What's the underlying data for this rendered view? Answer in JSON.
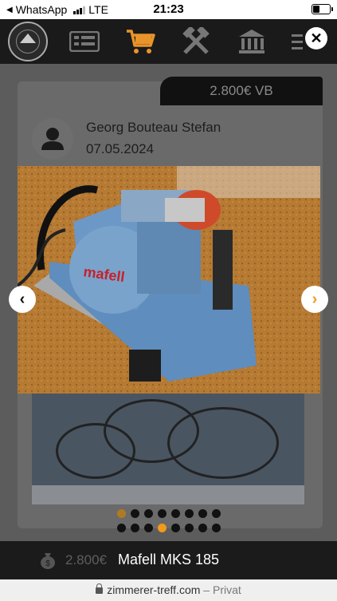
{
  "status_bar": {
    "back_app": "WhatsApp",
    "network": "LTE",
    "time": "21:23",
    "battery_percent": 30
  },
  "nav": {
    "icons": [
      "logo-emblem",
      "list-icon",
      "cart-icon",
      "tools-icon",
      "bank-icon",
      "menu-icon"
    ],
    "active_color": "#e8942a",
    "close_symbol": "✕"
  },
  "listing": {
    "price_badge": "2.800€ VB",
    "seller_name": "Georg Bouteau Stefan",
    "date": "07.05.2024",
    "photo_brand": "mafell",
    "prev_symbol": "‹",
    "next_symbol": "›"
  },
  "gallery": {
    "row1_count": 8,
    "row1_active": 0,
    "row2_count": 8,
    "row2_active": 3
  },
  "bottom_bar": {
    "price": "2.800€",
    "title": "Mafell MKS 185"
  },
  "url_bar": {
    "domain": "zimmerer-treff.com",
    "separator": "–",
    "mode": "Privat"
  },
  "colors": {
    "accent": "#f29a1a",
    "nav_bg": "#1a1a1a",
    "overlay": "#5c5c5c"
  }
}
